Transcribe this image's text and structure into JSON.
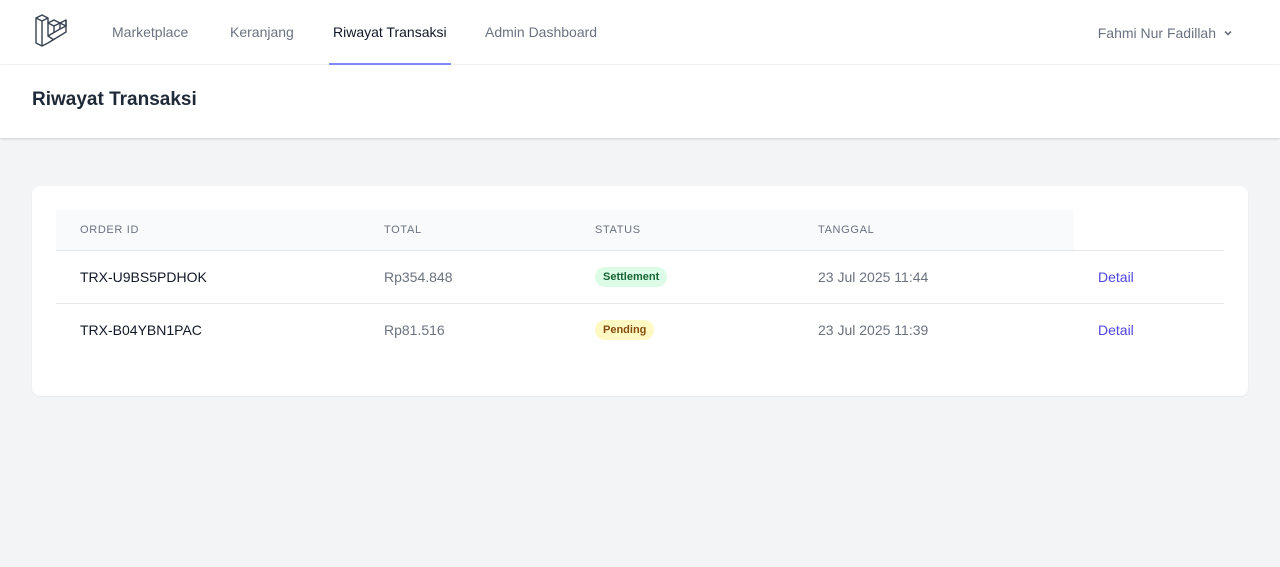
{
  "nav": {
    "links": [
      {
        "label": "Marketplace"
      },
      {
        "label": "Keranjang"
      },
      {
        "label": "Riwayat Transaksi"
      },
      {
        "label": "Admin Dashboard"
      }
    ],
    "active": "Riwayat Transaksi",
    "user_name": "Fahmi Nur Fadillah",
    "logo_icon": "laravel-logo-icon",
    "user_menu_icon": "chevron-down-icon"
  },
  "header": {
    "title": "Riwayat Transaksi"
  },
  "table": {
    "columns": [
      "ORDER ID",
      "TOTAL",
      "STATUS",
      "TANGGAL"
    ],
    "rows": [
      {
        "order_id": "TRX-U9BS5PDHOK",
        "total": "Rp354.848",
        "status": "Settlement",
        "date": "23 Jul 2025 11:44",
        "action": "Detail"
      },
      {
        "order_id": "TRX-B04YBN1PAC",
        "total": "Rp81.516",
        "status": "Pending",
        "date": "23 Jul 2025 11:39",
        "action": "Detail"
      }
    ]
  },
  "colors": {
    "accent": "#818cf8",
    "link": "#4f46e5",
    "settlement_bg": "#dcfce7",
    "settlement_text": "#166534",
    "pending_bg": "#fef9c3",
    "pending_text": "#854d0e"
  }
}
